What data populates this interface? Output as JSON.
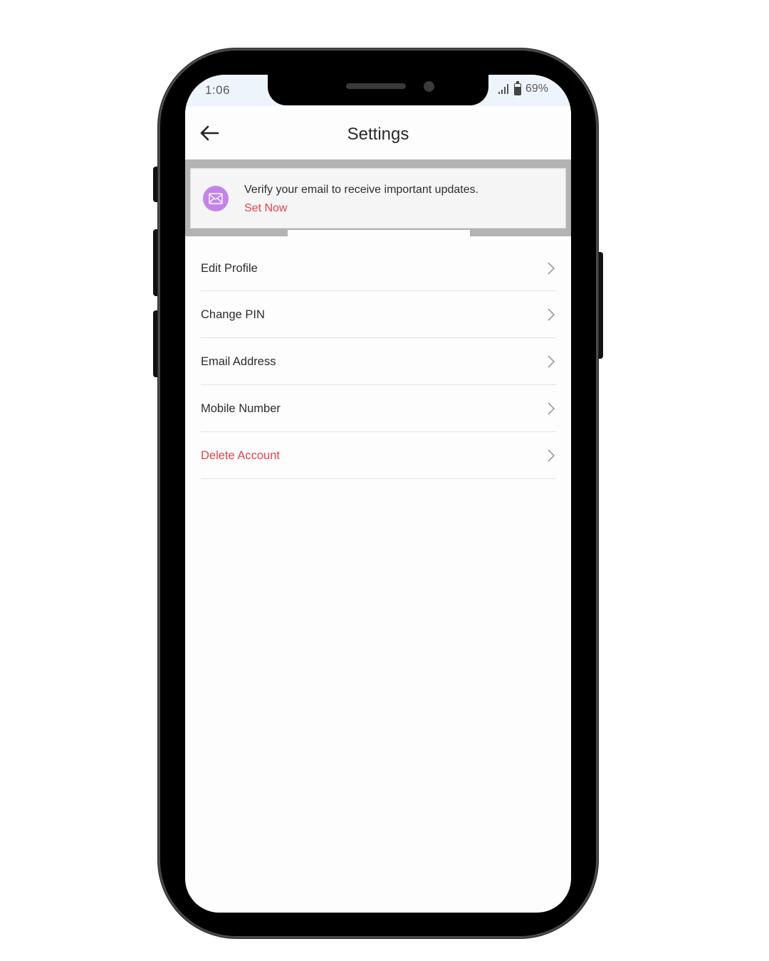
{
  "status_bar": {
    "time": "1:06",
    "battery_percent": "69%",
    "battery_level": 0.69
  },
  "header": {
    "title": "Settings",
    "back_icon": "arrow-left-icon"
  },
  "banner": {
    "icon": "mail-icon",
    "icon_bg_color": "#c284e8",
    "message": "Verify your email to receive important updates.",
    "action_label": "Set Now",
    "action_color": "#e8414b"
  },
  "menu": {
    "items": [
      {
        "label": "Edit Profile",
        "danger": false
      },
      {
        "label": "Change PIN",
        "danger": false
      },
      {
        "label": "Email Address",
        "danger": false
      },
      {
        "label": "Mobile Number",
        "danger": false
      },
      {
        "label": "Delete Account",
        "danger": true
      }
    ]
  },
  "colors": {
    "danger": "#e8414b",
    "status_bar_bg": "#eef4fb",
    "banner_overlay": "#b3b3b3"
  }
}
